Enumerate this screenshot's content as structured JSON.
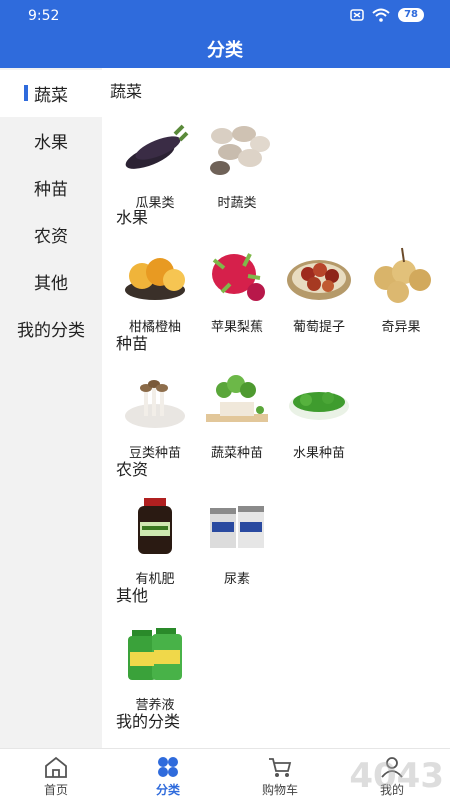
{
  "status": {
    "time": "9:52",
    "battery": "78"
  },
  "header": {
    "title": "分类"
  },
  "sidebar": {
    "items": [
      {
        "label": "蔬菜",
        "active": true
      },
      {
        "label": "水果",
        "active": false
      },
      {
        "label": "种苗",
        "active": false
      },
      {
        "label": "农资",
        "active": false
      },
      {
        "label": "其他",
        "active": false
      },
      {
        "label": "我的分类",
        "active": false
      }
    ]
  },
  "sections": [
    {
      "title": "蔬菜",
      "items": [
        "瓜果类",
        "时蔬类"
      ]
    },
    {
      "title": "水果",
      "items": [
        "柑橘橙柚",
        "苹果梨蕉",
        "葡萄提子",
        "奇异果"
      ]
    },
    {
      "title": "种苗",
      "items": [
        "豆类种苗",
        "蔬菜种苗",
        "水果种苗"
      ]
    },
    {
      "title": "农资",
      "items": [
        "有机肥",
        "尿素"
      ]
    },
    {
      "title": "其他",
      "items": [
        "营养液"
      ]
    },
    {
      "title": "我的分类",
      "items": []
    }
  ],
  "bottom_nav": [
    {
      "label": "首页",
      "active": false
    },
    {
      "label": "分类",
      "active": true
    },
    {
      "label": "购物车",
      "active": false
    },
    {
      "label": "我的",
      "active": false
    }
  ],
  "colors": {
    "primary": "#2f6bdc",
    "sidebar_bg": "#f2f2f2"
  },
  "watermark": "4043"
}
